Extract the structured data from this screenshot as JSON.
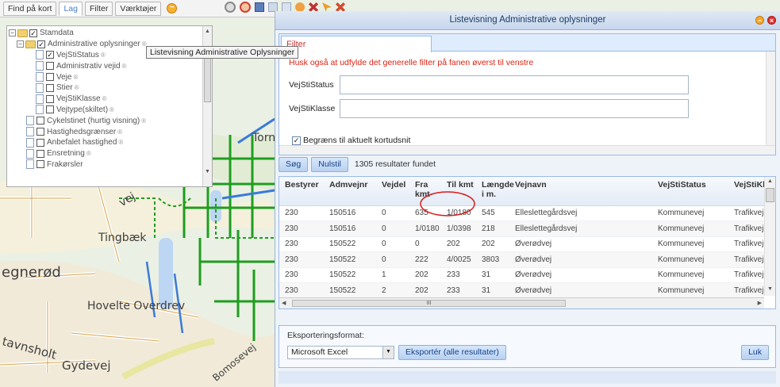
{
  "tabs": {
    "find": "Find på kort",
    "layers": "Lag",
    "filter": "Filter",
    "tools": "Værktøjer"
  },
  "map_labels": {
    "torne": "Torne",
    "vej": "vej",
    "tingbaek": "Tingbæk",
    "egnerod": "egnerød",
    "hovelte": "Hovelte Overdrev",
    "tavnsholt": "tavnsholt",
    "gydevej": "Gydevej",
    "bomosevej": "Bomosevej"
  },
  "layer_tree": {
    "root": "Stamdata",
    "admin": "Administrative oplysninger",
    "items": [
      "VejStiStatus",
      "Administrativ vejid",
      "Veje",
      "Stier",
      "VejStiKlasse",
      "Vejtype(skiltet)"
    ],
    "other": [
      "Cykelstinet (hurtig visning)",
      "Hastighedsgrænser",
      "Anbefalet hastighed",
      "Ensretning",
      "Frakørsler"
    ]
  },
  "tooltip": "Listevisning Administrative Oplysninger",
  "window_title": "Listevisning Administrative oplysninger",
  "filter": {
    "tab": "Filter",
    "note": "Husk også at udfylde det generelle filter på fanen øverst til venstre",
    "field1_label": "VejStiStatus",
    "field1_value": "",
    "field2_label": "VejStiKlasse",
    "field2_value": "",
    "limit_label": "Begræns til aktuelt kortudsnit",
    "limit_checked": true
  },
  "actions": {
    "search": "Søg",
    "reset": "Nulstil",
    "results": "1305 resultater fundet"
  },
  "grid": {
    "columns": [
      "Bestyrer",
      "Admvejnr",
      "Vejdel",
      "Fra kmt",
      "Til kmt",
      "Længde i m.",
      "Vejnavn",
      "VejStiStatus",
      "VejStiKlasse"
    ],
    "rows": [
      [
        "230",
        "150516",
        "0",
        "635",
        "1/0180",
        "545",
        "Elleslettegårdsvej",
        "Kommunevej",
        "Trafikvej, genn"
      ],
      [
        "230",
        "150516",
        "0",
        "1/0180",
        "1/0398",
        "218",
        "Elleslettegårdsvej",
        "Kommunevej",
        "Trafikvej, prim"
      ],
      [
        "230",
        "150522",
        "0",
        "0",
        "202",
        "202",
        "Øverødvej",
        "Kommunevej",
        "Trafikvej, prim"
      ],
      [
        "230",
        "150522",
        "0",
        "222",
        "4/0025",
        "3803",
        "Øverødvej",
        "Kommunevej",
        "Trafikvej, prim"
      ],
      [
        "230",
        "150522",
        "1",
        "202",
        "233",
        "31",
        "Øverødvej",
        "Kommunevej",
        "Trafikvej, prim"
      ],
      [
        "230",
        "150522",
        "2",
        "202",
        "233",
        "31",
        "Øverødvej",
        "Kommunevej",
        "Trafikvej, prim"
      ]
    ],
    "scroll_mark": "III"
  },
  "export": {
    "label": "Eksporteringsformat:",
    "format": "Microsoft Excel",
    "button": "Eksportér (alle resultater)",
    "close": "Luk"
  },
  "colors": {
    "road_green": "#1e9e1e",
    "water_blue": "#3a7ad8",
    "panel_blue": "#99bbe8",
    "annotation_red": "#d81c1c"
  }
}
